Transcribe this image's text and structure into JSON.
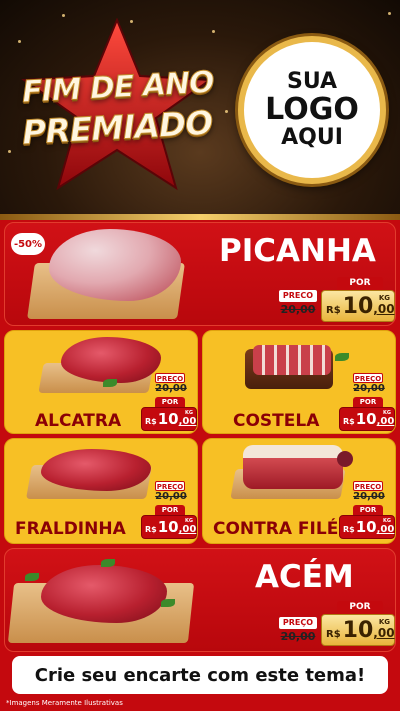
{
  "header": {
    "title_line1": "FIM DE ANO",
    "title_line2": "PREMIADO",
    "logo_line1": "SUA",
    "logo_line2": "LOGO",
    "logo_line3": "AQUI"
  },
  "products": [
    {
      "name": "PICANHA",
      "discount_badge": "-50%",
      "preco_label": "PRECO",
      "old_price": "20,00",
      "por_label": "POR",
      "currency": "R$",
      "price_int": "10",
      "price_cents": ",00",
      "unit": "KG"
    },
    {
      "name": "ALCATRA",
      "preco_label": "PREÇO",
      "old_price": "20,00",
      "por_label": "POR",
      "currency": "R$",
      "price_int": "10",
      "price_cents": ",00",
      "unit": "KG"
    },
    {
      "name": "COSTELA",
      "preco_label": "PREÇO",
      "old_price": "20,00",
      "por_label": "POR",
      "currency": "R$",
      "price_int": "10",
      "price_cents": ",00",
      "unit": "KG"
    },
    {
      "name": "FRALDINHA",
      "preco_label": "PREÇO",
      "old_price": "20,00",
      "por_label": "POR",
      "currency": "R$",
      "price_int": "10",
      "price_cents": ",00",
      "unit": "KG"
    },
    {
      "name": "CONTRA FILÉ",
      "preco_label": "PREÇO",
      "old_price": "20,00",
      "por_label": "POR",
      "currency": "R$",
      "price_int": "10",
      "price_cents": ",00",
      "unit": "KG"
    },
    {
      "name": "ACÉM",
      "preco_label": "PREÇO",
      "old_price": "20,00",
      "por_label": "POR",
      "currency": "R$",
      "price_int": "10",
      "price_cents": ",00",
      "unit": "KG"
    }
  ],
  "footer": {
    "cta": "Crie seu encarte com este tema!",
    "disclaimer": "*Imagens Meramente Ilustrativas"
  },
  "colors": {
    "brand_red": "#c4090e",
    "card_yellow": "#f7c025",
    "gold": "#e9b84a",
    "dark_name": "#8a0006"
  }
}
